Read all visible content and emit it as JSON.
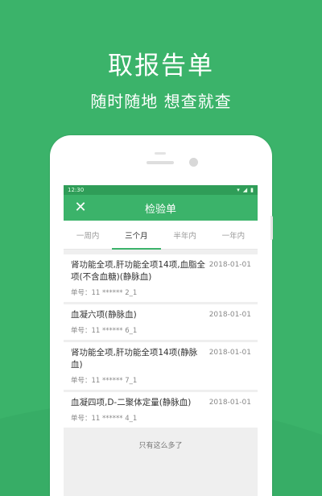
{
  "hero": {
    "title": "取报告单",
    "subtitle": "随时随地  想查就查"
  },
  "status_bar": {
    "time": "12:30"
  },
  "app_bar": {
    "title": "检验单",
    "close_icon": "close-icon"
  },
  "tabs": [
    {
      "label": "一周内",
      "active": false
    },
    {
      "label": "三个月",
      "active": true
    },
    {
      "label": "半年内",
      "active": false
    },
    {
      "label": "一年内",
      "active": false
    }
  ],
  "reports": [
    {
      "name": "肾功能全项,肝功能全项14项,血脂全项(不含血糖)(静脉血)",
      "date": "2018-01-01",
      "number": "单号：11 ****** 2_1"
    },
    {
      "name": "血凝六项(静脉血)",
      "date": "2018-01-01",
      "number": "单号：11 ****** 6_1"
    },
    {
      "name": "肾功能全项,肝功能全项14项(静脉血)",
      "date": "2018-01-01",
      "number": "单号：11 ****** 7_1"
    },
    {
      "name": "血凝四项,D-二聚体定量(静脉血)",
      "date": "2018-01-01",
      "number": "单号：11 ****** 4_1"
    }
  ],
  "footer_text": "只有这么多了",
  "colors": {
    "brand_green": "#3bb36a",
    "status_green": "#2f9d58"
  }
}
